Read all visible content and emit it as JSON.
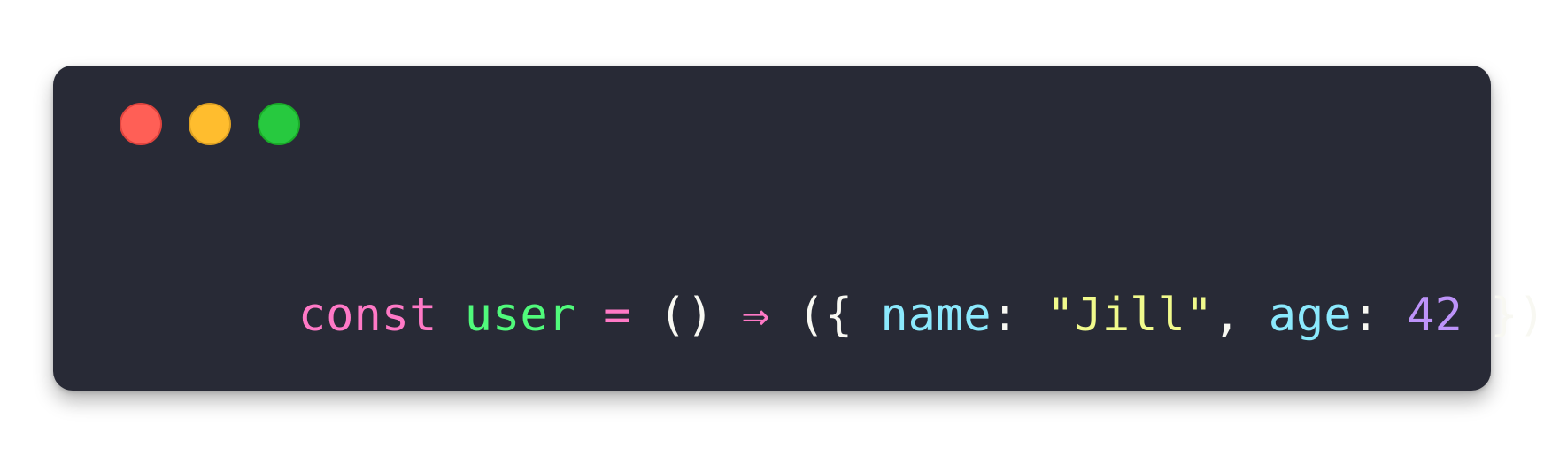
{
  "window": {
    "controls": [
      {
        "name": "close-button",
        "color": "#ff5f56"
      },
      {
        "name": "minimize-button",
        "color": "#ffbd2e"
      },
      {
        "name": "maximize-button",
        "color": "#27c93f"
      }
    ]
  },
  "code": {
    "tokens": [
      {
        "text": "const",
        "color": "#ff79c6"
      },
      {
        "text": " ",
        "color": "#f8f8f2"
      },
      {
        "text": "user",
        "color": "#50fa7b"
      },
      {
        "text": " ",
        "color": "#f8f8f2"
      },
      {
        "text": "=",
        "color": "#ff79c6"
      },
      {
        "text": " ",
        "color": "#f8f8f2"
      },
      {
        "text": "()",
        "color": "#f8f8f2"
      },
      {
        "text": " ",
        "color": "#f8f8f2"
      },
      {
        "text": "⇒",
        "color": "#ff79c6"
      },
      {
        "text": " ",
        "color": "#f8f8f2"
      },
      {
        "text": "({",
        "color": "#f8f8f2"
      },
      {
        "text": " ",
        "color": "#f8f8f2"
      },
      {
        "text": "name",
        "color": "#8be9fd"
      },
      {
        "text": ": ",
        "color": "#f8f8f2"
      },
      {
        "text": "\"Jill\"",
        "color": "#f1fa8c"
      },
      {
        "text": ", ",
        "color": "#f8f8f2"
      },
      {
        "text": "age",
        "color": "#8be9fd"
      },
      {
        "text": ": ",
        "color": "#f8f8f2"
      },
      {
        "text": "42",
        "color": "#bd93f9"
      },
      {
        "text": " ",
        "color": "#f8f8f2"
      },
      {
        "text": "});",
        "color": "#f8f8f2"
      }
    ]
  }
}
